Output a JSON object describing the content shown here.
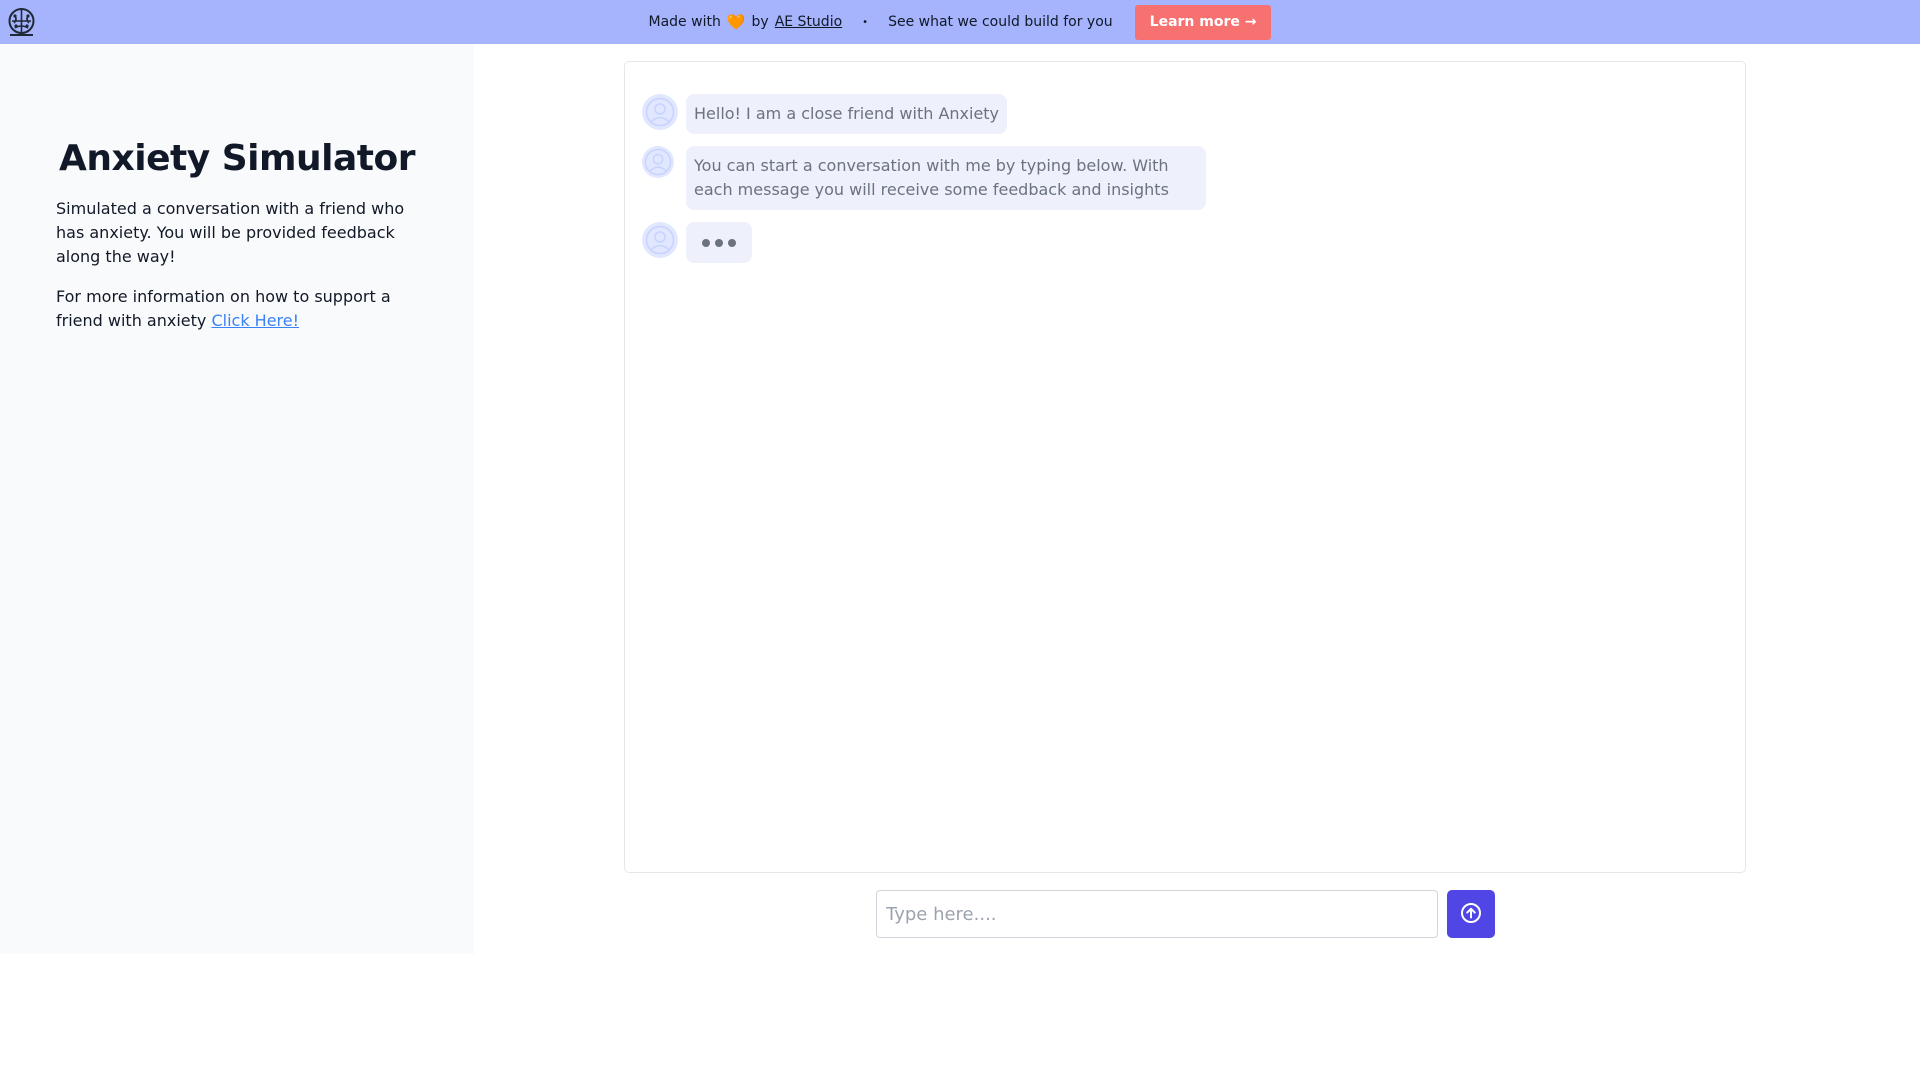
{
  "banner": {
    "made_with": "Made with",
    "heart": "🧡",
    "by": "by",
    "brand": "AE Studio",
    "separator": "•",
    "tagline": "See what we could build for you",
    "learn_more": "Learn more →"
  },
  "sidebar": {
    "title": "Anxiety Simulator",
    "description": "Simulated a conversation with a friend who has anxiety. You will be provided feedback along the way!",
    "info_text": "For more information on how to support a friend with anxiety ",
    "link_label": "Click Here!"
  },
  "chat": {
    "messages": [
      {
        "text": "Hello! I am a close friend with Anxiety"
      },
      {
        "text": "You can start a conversation with me by typing below. With each message you will receive some feedback and insights"
      }
    ],
    "typing_indicator": true
  },
  "input": {
    "placeholder": "Type here....",
    "value": ""
  },
  "colors": {
    "banner_bg": "#a5b4fc",
    "learn_more_bg": "#f87171",
    "send_button_bg": "#4f46e5",
    "bubble_bg": "#eef0fb",
    "link": "#3b82f6"
  },
  "icons": {
    "logo": "brain-logo-icon",
    "avatar": "user-avatar-icon",
    "send": "arrow-up-circle-icon"
  }
}
